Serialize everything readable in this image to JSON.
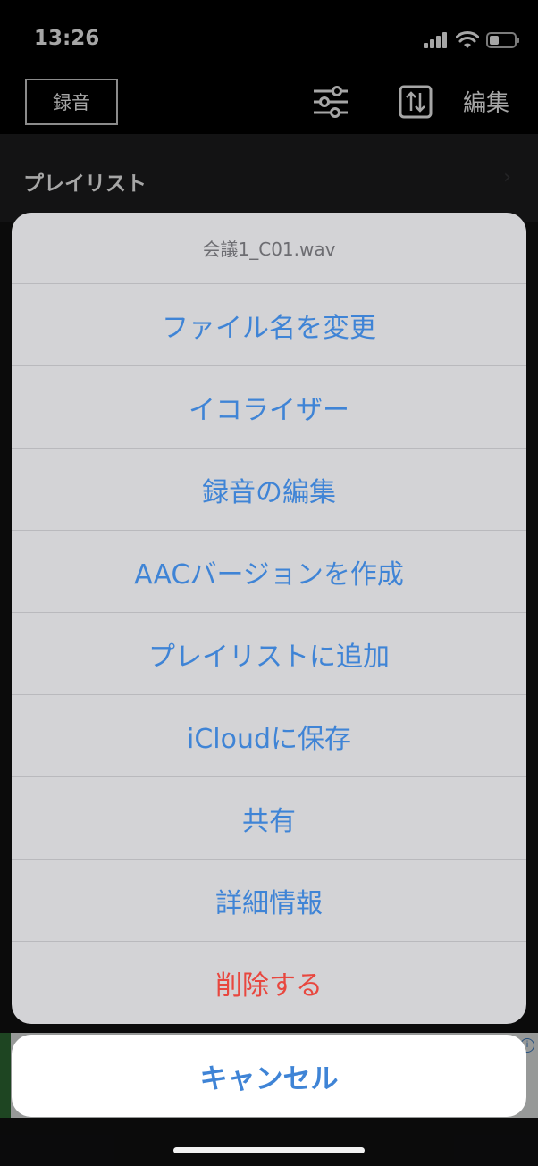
{
  "status_bar": {
    "time": "13:26"
  },
  "nav_bar": {
    "record_label": "録音",
    "edit_label": "編集"
  },
  "content": {
    "playlist_label": "プレイリスト",
    "chevron": "›"
  },
  "action_sheet": {
    "title": "会議1_C01.wav",
    "items": [
      {
        "label": "ファイル名を変更"
      },
      {
        "label": "イコライザー"
      },
      {
        "label": "録音の編集"
      },
      {
        "label": "AACバージョンを作成"
      },
      {
        "label": "プレイリストに追加"
      },
      {
        "label": "iCloudに保存"
      },
      {
        "label": "共有"
      },
      {
        "label": "詳細情報"
      },
      {
        "label": "削除する"
      }
    ],
    "cancel_label": "キャンセル"
  },
  "ad": {
    "info_glyph": "i"
  },
  "colors": {
    "accent": "#3f84d6",
    "destructive": "#e8473f",
    "sheet_background": "#d3d3d6"
  }
}
